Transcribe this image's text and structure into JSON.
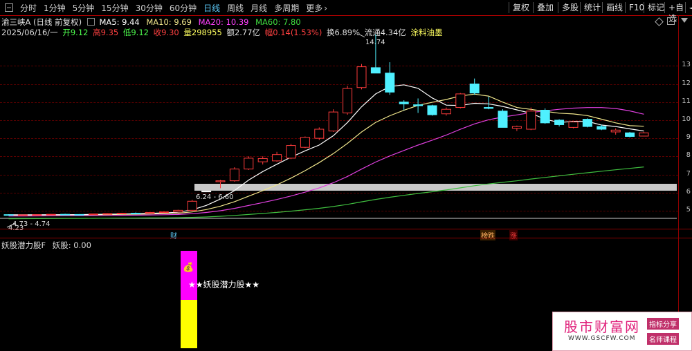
{
  "toolbar": {
    "timeframes": [
      "分时",
      "1分钟",
      "5分钟",
      "15分钟",
      "30分钟",
      "60分钟",
      "日线",
      "周线",
      "月线",
      "多周期",
      "更多"
    ],
    "active": "日线",
    "more_chevron": "›",
    "right_buttons": [
      "复权",
      "叠加",
      "多股",
      "统计",
      "画线",
      "F10",
      "标记",
      "+自选",
      "◄"
    ]
  },
  "stock": {
    "title": "渝三峡A (日线 前复权)",
    "ma5": "MA5: 9.44",
    "ma10": "MA10: 9.69",
    "ma20": "MA20: 10.39",
    "ma60": "MA60: 7.80",
    "date": "2025/06/16/一",
    "open": "开9.12",
    "high": "高9.35",
    "low": "低9.12",
    "close": "收9.30",
    "volume": "量298955",
    "amount": "额2.77亿",
    "change": "幅0.14(1.53%)",
    "turnover": "换6.89%",
    "float": "流通4.34亿",
    "sector": "涂料油墨"
  },
  "yaxis_ticks": [
    "13",
    "12",
    "11",
    "10",
    "9",
    "8",
    "7",
    "6",
    "5"
  ],
  "annotations": {
    "high_label": "14.74",
    "range_label": "6.24 - 6.60",
    "low_label": "4.73 - 4.74",
    "low_label2": "4.23"
  },
  "tags": {
    "cai": "财",
    "bang": "榜跌",
    "zhang": "涨"
  },
  "indicator": {
    "title": "妖股潜力股F",
    "value": "妖股: 0.00",
    "bar_text": "★★妖股潜力股★★",
    "icon": "money-bag-icon",
    "bag_glyph": "💰"
  },
  "watermark": {
    "brand": "股市财富网",
    "url": "WWW.GSCFW.COM",
    "tag1": "指标分享",
    "tag2": "名师课程"
  },
  "colors": {
    "up": "#ff3c3c",
    "down": "#4ff0ff",
    "ma5": "#ffffff",
    "ma10": "#f0e68c",
    "ma20": "#e040e0",
    "ma60": "#40c040",
    "bar_yellow": "#ffff00",
    "bar_magenta": "#ff00ff"
  },
  "chart_data": {
    "type": "candlestick",
    "candles": [
      {
        "o": 4.78,
        "h": 4.8,
        "l": 4.74,
        "c": 4.76
      },
      {
        "o": 4.76,
        "h": 4.79,
        "l": 4.73,
        "c": 4.77
      },
      {
        "o": 4.77,
        "h": 4.8,
        "l": 4.75,
        "c": 4.78
      },
      {
        "o": 4.78,
        "h": 4.82,
        "l": 4.76,
        "c": 4.8
      },
      {
        "o": 4.8,
        "h": 4.83,
        "l": 4.77,
        "c": 4.79
      },
      {
        "o": 4.79,
        "h": 4.81,
        "l": 4.76,
        "c": 4.78
      },
      {
        "o": 4.78,
        "h": 4.83,
        "l": 4.77,
        "c": 4.82
      },
      {
        "o": 4.82,
        "h": 4.86,
        "l": 4.8,
        "c": 4.84
      },
      {
        "o": 4.84,
        "h": 4.88,
        "l": 4.82,
        "c": 4.86
      },
      {
        "o": 4.86,
        "h": 4.9,
        "l": 4.84,
        "c": 4.85
      },
      {
        "o": 4.85,
        "h": 4.92,
        "l": 4.84,
        "c": 4.9
      },
      {
        "o": 4.9,
        "h": 4.95,
        "l": 4.88,
        "c": 4.93
      },
      {
        "o": 4.93,
        "h": 5.05,
        "l": 4.91,
        "c": 5.02
      },
      {
        "o": 5.02,
        "h": 5.6,
        "l": 5.0,
        "c": 5.52
      },
      {
        "o": 6.08,
        "h": 6.08,
        "l": 6.08,
        "c": 6.08
      },
      {
        "o": 6.6,
        "h": 6.7,
        "l": 6.24,
        "c": 6.65
      },
      {
        "o": 6.65,
        "h": 7.4,
        "l": 6.6,
        "c": 7.3
      },
      {
        "o": 7.3,
        "h": 8.0,
        "l": 7.25,
        "c": 7.9
      },
      {
        "o": 7.7,
        "h": 8.0,
        "l": 7.55,
        "c": 7.88
      },
      {
        "o": 7.75,
        "h": 8.25,
        "l": 7.7,
        "c": 8.1
      },
      {
        "o": 7.9,
        "h": 8.7,
        "l": 7.85,
        "c": 8.6
      },
      {
        "o": 8.5,
        "h": 9.1,
        "l": 8.45,
        "c": 9.05
      },
      {
        "o": 9.0,
        "h": 9.6,
        "l": 8.9,
        "c": 9.5
      },
      {
        "o": 9.4,
        "h": 10.6,
        "l": 9.35,
        "c": 10.45
      },
      {
        "o": 10.4,
        "h": 11.9,
        "l": 10.3,
        "c": 11.75
      },
      {
        "o": 11.8,
        "h": 13.1,
        "l": 11.7,
        "c": 12.95
      },
      {
        "o": 12.9,
        "h": 14.74,
        "l": 12.8,
        "c": 12.6
      },
      {
        "o": 12.6,
        "h": 13.2,
        "l": 11.4,
        "c": 11.55
      },
      {
        "o": 11.0,
        "h": 11.1,
        "l": 10.55,
        "c": 10.9
      },
      {
        "o": 10.85,
        "h": 11.2,
        "l": 10.4,
        "c": 10.8
      },
      {
        "o": 10.8,
        "h": 10.85,
        "l": 10.25,
        "c": 10.3
      },
      {
        "o": 10.35,
        "h": 10.7,
        "l": 10.25,
        "c": 10.6
      },
      {
        "o": 10.7,
        "h": 11.5,
        "l": 10.65,
        "c": 11.45
      },
      {
        "o": 12.0,
        "h": 12.3,
        "l": 11.4,
        "c": 11.5
      },
      {
        "o": 10.7,
        "h": 11.3,
        "l": 10.6,
        "c": 10.65
      },
      {
        "o": 10.5,
        "h": 10.6,
        "l": 9.6,
        "c": 9.6
      },
      {
        "o": 9.55,
        "h": 9.7,
        "l": 9.4,
        "c": 9.65
      },
      {
        "o": 9.5,
        "h": 10.7,
        "l": 9.45,
        "c": 10.5
      },
      {
        "o": 10.55,
        "h": 10.65,
        "l": 9.8,
        "c": 9.85
      },
      {
        "o": 10.0,
        "h": 10.05,
        "l": 9.65,
        "c": 9.75
      },
      {
        "o": 9.6,
        "h": 9.95,
        "l": 9.55,
        "c": 9.9
      },
      {
        "o": 10.05,
        "h": 10.1,
        "l": 9.6,
        "c": 9.65
      },
      {
        "o": 9.65,
        "h": 9.75,
        "l": 9.45,
        "c": 9.5
      },
      {
        "o": 9.35,
        "h": 9.55,
        "l": 9.2,
        "c": 9.45
      },
      {
        "o": 9.3,
        "h": 9.35,
        "l": 9.05,
        "c": 9.1
      },
      {
        "o": 9.12,
        "h": 9.35,
        "l": 9.12,
        "c": 9.3
      }
    ],
    "xlabel": "",
    "ylabel": "",
    "ylim": [
      4.2,
      15.0
    ]
  }
}
